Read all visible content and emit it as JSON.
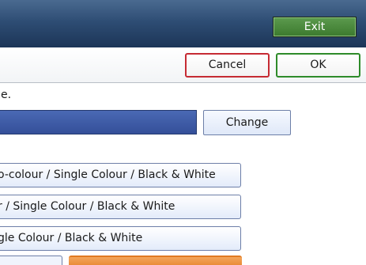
{
  "header": {
    "exit_label": "Exit"
  },
  "actions": {
    "cancel_label": "Cancel",
    "ok_label": "OK"
  },
  "message": "e.",
  "change_label": "Change",
  "options": [
    "o-colour / Single Colour / Black & White",
    "r / Single Colour / Black & White",
    "gle Colour / Black & White"
  ]
}
